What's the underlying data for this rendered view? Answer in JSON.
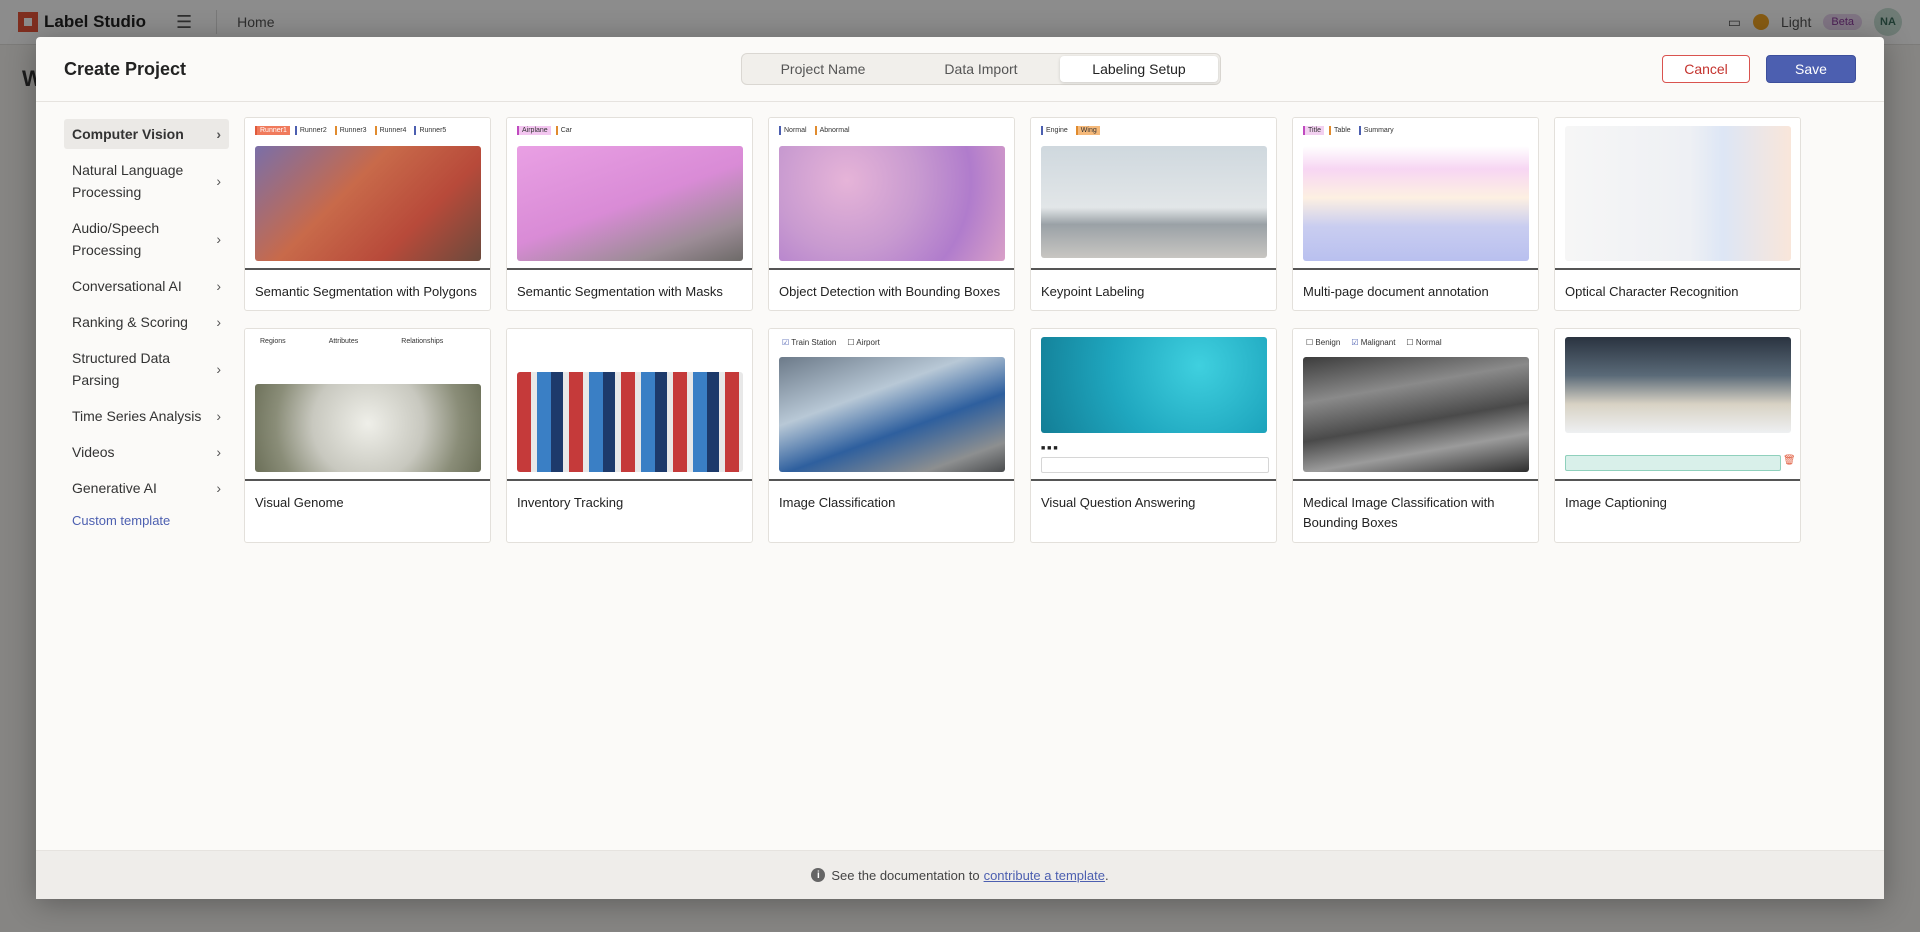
{
  "app": {
    "logo": "Label Studio",
    "breadcrumb": "Home",
    "theme": "Light",
    "beta": "Beta",
    "avatar": "NA",
    "bg_title": "W"
  },
  "modal": {
    "title": "Create Project",
    "tabs": [
      "Project Name",
      "Data Import",
      "Labeling Setup"
    ],
    "active_tab": "Labeling Setup",
    "cancel": "Cancel",
    "save": "Save"
  },
  "sidebar": {
    "items": [
      {
        "label": "Computer Vision"
      },
      {
        "label": "Natural Language Processing"
      },
      {
        "label": "Audio/Speech Processing"
      },
      {
        "label": "Conversational AI"
      },
      {
        "label": "Ranking & Scoring"
      },
      {
        "label": "Structured Data Parsing"
      },
      {
        "label": "Time Series Analysis"
      },
      {
        "label": "Videos"
      },
      {
        "label": "Generative AI"
      }
    ],
    "custom": "Custom template"
  },
  "templates": [
    {
      "name": "Semantic Segmentation with Polygons",
      "chips": [
        "Runner1",
        "Runner2",
        "Runner3",
        "Runner4",
        "Runner5"
      ]
    },
    {
      "name": "Semantic Segmentation with Masks",
      "chips": [
        "Airplane",
        "Car"
      ]
    },
    {
      "name": "Object Detection with Bounding Boxes",
      "chips": [
        "Normal",
        "Abnormal"
      ]
    },
    {
      "name": "Keypoint Labeling",
      "chips": [
        "Engine",
        "Wing"
      ]
    },
    {
      "name": "Multi-page document annotation",
      "chips": [
        "Title",
        "Table",
        "Summary"
      ]
    },
    {
      "name": "Optical Character Recognition",
      "chips": []
    },
    {
      "name": "Visual Genome",
      "chips": [
        "Regions",
        "Attributes",
        "Relationships"
      ]
    },
    {
      "name": "Inventory Tracking",
      "chips": []
    },
    {
      "name": "Image Classification",
      "chips": [
        "Train Station",
        "Airport"
      ]
    },
    {
      "name": "Visual Question Answering",
      "chips": []
    },
    {
      "name": "Medical Image Classification with Bounding Boxes",
      "chips": [
        "Benign",
        "Malignant",
        "Normal"
      ]
    },
    {
      "name": "Image Captioning",
      "chips": []
    }
  ],
  "footer": {
    "text": "See the documentation to",
    "link": "contribute a template"
  }
}
